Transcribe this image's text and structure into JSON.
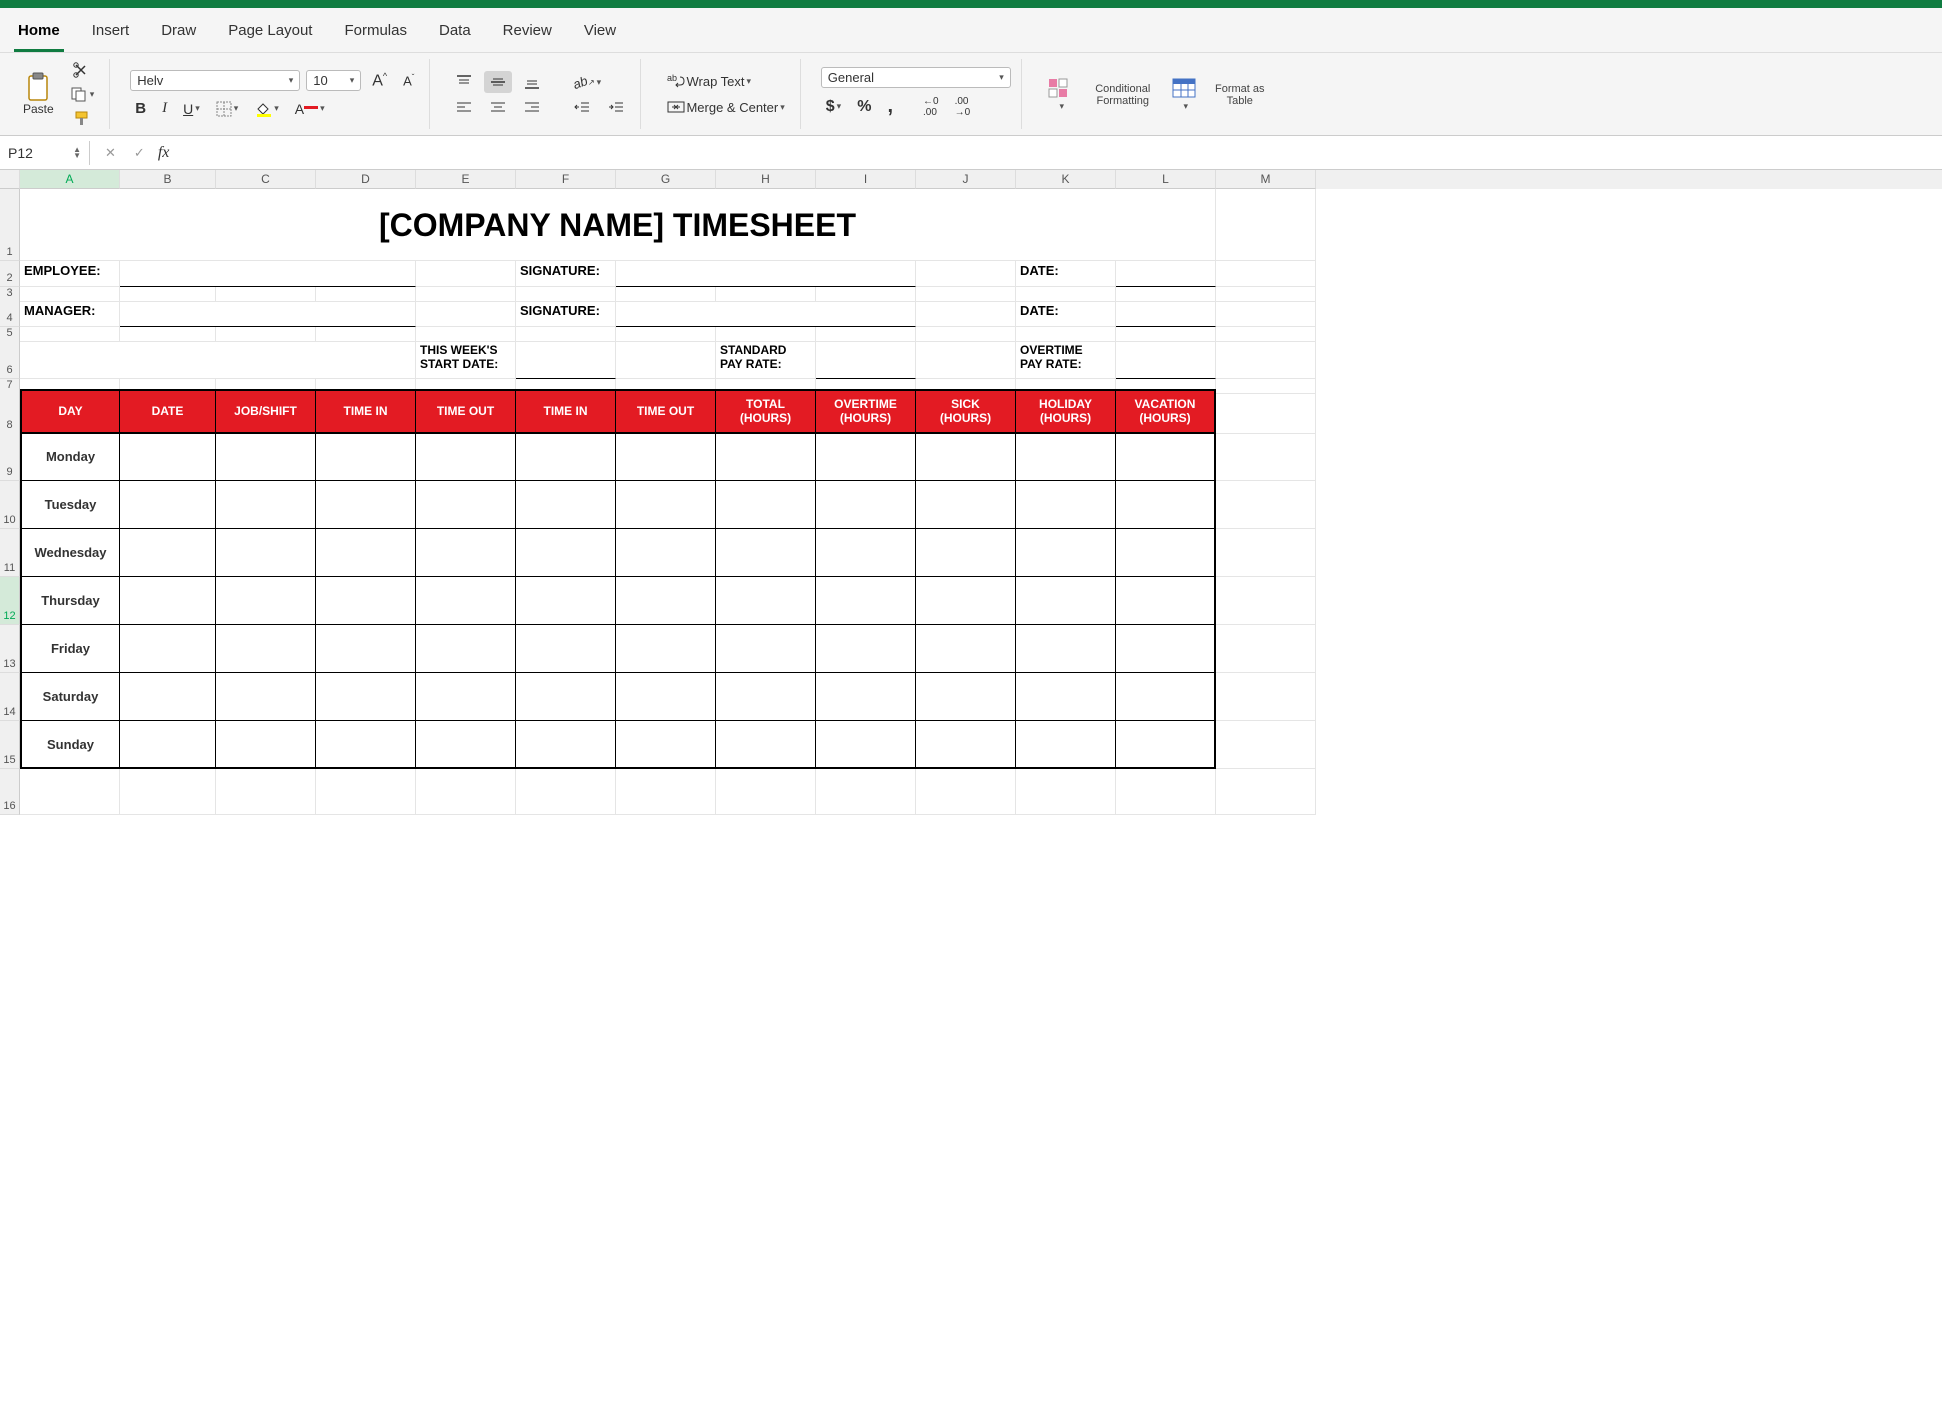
{
  "tabs": [
    "Home",
    "Insert",
    "Draw",
    "Page Layout",
    "Formulas",
    "Data",
    "Review",
    "View"
  ],
  "activeTab": "Home",
  "clipboard": {
    "paste": "Paste"
  },
  "font": {
    "name": "Helv",
    "size": "10"
  },
  "wrap": "Wrap Text",
  "merge": "Merge & Center",
  "numfmt": "General",
  "styles": {
    "cond": "Conditional Formatting",
    "table": "Format as Table"
  },
  "namebox": "P12",
  "formula": "",
  "cols": [
    "A",
    "B",
    "C",
    "D",
    "E",
    "F",
    "G",
    "H",
    "I",
    "J",
    "K",
    "L",
    "M"
  ],
  "selectedCol": "A",
  "selectedRow": 12,
  "doc": {
    "title": "[COMPANY NAME] TIMESHEET",
    "row2": {
      "employee": "EMPLOYEE:",
      "signature": "SIGNATURE:",
      "date": "DATE:"
    },
    "row4": {
      "manager": "MANAGER:",
      "signature": "SIGNATURE:",
      "date": "DATE:"
    },
    "row6": {
      "week": "THIS WEEK'S\nSTART DATE:",
      "std": "STANDARD\nPAY RATE:",
      "ot": "OVERTIME\nPAY RATE:"
    },
    "headers": [
      "DAY",
      "DATE",
      "JOB/SHIFT",
      "TIME IN",
      "TIME OUT",
      "TIME IN",
      "TIME OUT",
      "TOTAL\n(HOURS)",
      "OVERTIME\n(HOURS)",
      "SICK\n(HOURS)",
      "HOLIDAY\n(HOURS)",
      "VACATION\n(HOURS)"
    ],
    "days": [
      "Monday",
      "Tuesday",
      "Wednesday",
      "Thursday",
      "Friday",
      "Saturday",
      "Sunday"
    ]
  }
}
